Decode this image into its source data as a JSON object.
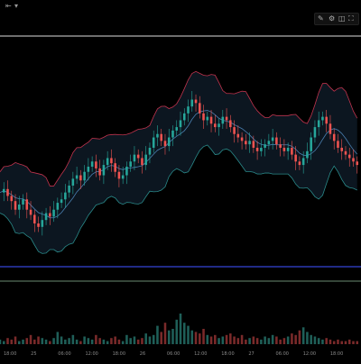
{
  "header": {
    "back_icon": "back-arrow-icon",
    "menu_icon": "menu-icon"
  },
  "toolbar": {
    "icons": [
      "pen-icon",
      "settings-icon",
      "screenshot-icon",
      "fullscreen-icon"
    ]
  },
  "colors": {
    "background": "#000000",
    "band_upper": "#c0334d",
    "band_lower": "#2a8a8a",
    "band_mid": "#4a7fb0",
    "band_fill": "#0c1620",
    "candle_up": "#26a69a",
    "candle_down": "#ef5350",
    "blue_line": "#3545d6",
    "green_line": "#6a8a70",
    "white_line": "#dddddd"
  },
  "chart_data": {
    "type": "candlestick",
    "indicator": "bollinger-bands",
    "x_ticks": [
      "18:00",
      "25",
      "06:00",
      "12:00",
      "18:00",
      "26",
      "06:00",
      "12:00",
      "18:00",
      "27",
      "06:00",
      "12:00",
      "18:00"
    ],
    "price_path": [
      40,
      42,
      38,
      35,
      30,
      33,
      36,
      30,
      27,
      22,
      20,
      24,
      28,
      26,
      30,
      34,
      36,
      40,
      44,
      48,
      50,
      47,
      52,
      55,
      58,
      54,
      50,
      56,
      60,
      57,
      52,
      48,
      50,
      55,
      58,
      62,
      60,
      56,
      62,
      66,
      72,
      74,
      70,
      67,
      72,
      76,
      78,
      82,
      86,
      90,
      94,
      92,
      86,
      82,
      84,
      80,
      78,
      80,
      84,
      82,
      78,
      74,
      72,
      70,
      68,
      70,
      66,
      64,
      66,
      68,
      70,
      72,
      68,
      66,
      64,
      66,
      62,
      58,
      56,
      60,
      64,
      72,
      78,
      82,
      84,
      80,
      74,
      70,
      66,
      64,
      62,
      60,
      58,
      56
    ],
    "volume": [
      3,
      2,
      4,
      3,
      5,
      2,
      3,
      4,
      6,
      3,
      5,
      4,
      3,
      2,
      4,
      8,
      5,
      3,
      4,
      6,
      3,
      2,
      5,
      4,
      3,
      6,
      4,
      3,
      2,
      4,
      5,
      3,
      2,
      6,
      4,
      5,
      3,
      4,
      7,
      5,
      6,
      12,
      8,
      14,
      9,
      10,
      16,
      20,
      14,
      12,
      9,
      8,
      7,
      10,
      6,
      5,
      6,
      4,
      5,
      6,
      7,
      5,
      4,
      6,
      3,
      4,
      5,
      4,
      3,
      5,
      4,
      6,
      5,
      3,
      4,
      5,
      7,
      6,
      9,
      11,
      8,
      6,
      5,
      4,
      3,
      4,
      3,
      2,
      3,
      2,
      2,
      3,
      2,
      2
    ]
  }
}
